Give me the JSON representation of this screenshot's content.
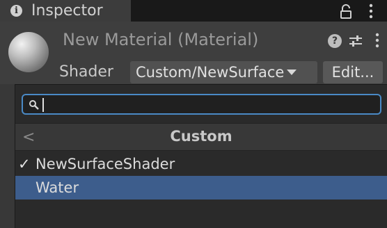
{
  "tab": {
    "title": "Inspector"
  },
  "header": {
    "material_title": "New Material (Material)",
    "shader_label": "Shader",
    "shader_value": "Custom/NewSurface",
    "edit_label": "Edit...",
    "help_glyph": "?"
  },
  "popup": {
    "search": {
      "value": "",
      "placeholder": ""
    },
    "nav": {
      "back_glyph": "<",
      "title": "Custom"
    },
    "items": [
      {
        "label": "NewSurfaceShader",
        "checked": true,
        "check_glyph": "✓"
      },
      {
        "label": "Water",
        "selected": true
      }
    ]
  },
  "colors": {
    "selection": "#3d5d8c",
    "focus_border": "#4a8ac6"
  }
}
